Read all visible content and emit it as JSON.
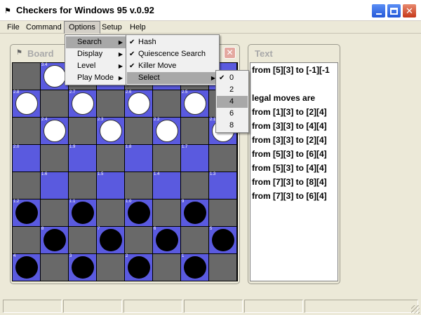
{
  "window": {
    "title": "Checkers for Windows 95 v.0.92",
    "icon": "checkers-app-icon"
  },
  "menubar": [
    "File",
    "Command",
    "Options",
    "Setup",
    "Help"
  ],
  "options_menu": [
    "Search",
    "Display",
    "Level",
    "Play Mode"
  ],
  "search_menu": [
    {
      "label": "Hash",
      "checked": true
    },
    {
      "label": "Quiescence Search",
      "checked": true
    },
    {
      "label": "Killer Move",
      "checked": true
    },
    {
      "label": "Select",
      "checked": false
    }
  ],
  "select_menu": [
    {
      "label": "0",
      "checked": true
    },
    {
      "label": "2",
      "checked": false
    },
    {
      "label": "4",
      "checked": false,
      "highlighted": true
    },
    {
      "label": "6",
      "checked": false
    },
    {
      "label": "8",
      "checked": false
    }
  ],
  "board_panel": {
    "title": "Board"
  },
  "board": {
    "rows": [
      [
        {
          "c": "dark"
        },
        {
          "c": "light",
          "n": "3.4",
          "p": "white"
        },
        {
          "c": "dark"
        },
        {
          "c": "light"
        },
        {
          "c": "dark"
        },
        {
          "c": "light"
        },
        {
          "c": "dark"
        },
        {
          "c": "light"
        }
      ],
      [
        {
          "c": "light",
          "n": "2.8",
          "p": "white"
        },
        {
          "c": "dark"
        },
        {
          "c": "light",
          "n": "2.7",
          "p": "white"
        },
        {
          "c": "dark"
        },
        {
          "c": "light",
          "n": "2.6",
          "p": "white"
        },
        {
          "c": "dark"
        },
        {
          "c": "light",
          "n": "2.5",
          "p": "white"
        },
        {
          "c": "dark"
        }
      ],
      [
        {
          "c": "dark"
        },
        {
          "c": "light",
          "n": "2.4",
          "p": "white"
        },
        {
          "c": "dark"
        },
        {
          "c": "light",
          "n": "2.3",
          "p": "white"
        },
        {
          "c": "dark"
        },
        {
          "c": "light",
          "n": "2.2",
          "p": "white"
        },
        {
          "c": "dark"
        },
        {
          "c": "light",
          "n": "2.1",
          "p": "white"
        }
      ],
      [
        {
          "c": "light",
          "n": "2.0"
        },
        {
          "c": "dark"
        },
        {
          "c": "light",
          "n": "1.9"
        },
        {
          "c": "dark"
        },
        {
          "c": "light",
          "n": "1.8"
        },
        {
          "c": "dark"
        },
        {
          "c": "light",
          "n": "1.7"
        },
        {
          "c": "dark"
        }
      ],
      [
        {
          "c": "dark"
        },
        {
          "c": "light",
          "n": "1.6"
        },
        {
          "c": "dark"
        },
        {
          "c": "light",
          "n": "1.5"
        },
        {
          "c": "dark"
        },
        {
          "c": "light",
          "n": "1.4"
        },
        {
          "c": "dark"
        },
        {
          "c": "light",
          "n": "1.3"
        }
      ],
      [
        {
          "c": "light",
          "n": "1.2",
          "p": "black"
        },
        {
          "c": "dark"
        },
        {
          "c": "light",
          "n": "1.1",
          "p": "black"
        },
        {
          "c": "dark"
        },
        {
          "c": "light",
          "n": "1.0",
          "p": "black"
        },
        {
          "c": "dark"
        },
        {
          "c": "light",
          "n": "9",
          "p": "black"
        },
        {
          "c": "dark"
        }
      ],
      [
        {
          "c": "dark"
        },
        {
          "c": "light",
          "n": "8",
          "p": "black"
        },
        {
          "c": "dark"
        },
        {
          "c": "light",
          "n": "7",
          "p": "black"
        },
        {
          "c": "dark"
        },
        {
          "c": "light",
          "n": "6",
          "p": "black"
        },
        {
          "c": "dark"
        },
        {
          "c": "light",
          "n": "5",
          "p": "black"
        }
      ],
      [
        {
          "c": "light",
          "n": "4",
          "p": "black"
        },
        {
          "c": "dark"
        },
        {
          "c": "light",
          "n": "3",
          "p": "black"
        },
        {
          "c": "dark"
        },
        {
          "c": "light",
          "n": "2",
          "p": "black"
        },
        {
          "c": "dark"
        },
        {
          "c": "light",
          "n": "1",
          "p": "black"
        },
        {
          "c": "dark"
        }
      ]
    ]
  },
  "text_panel": {
    "title": "Text",
    "lines": [
      "from [5][3] to [-1][-1",
      "",
      "legal moves are",
      "from [1][3] to [2][4]",
      "from [3][3] to [4][4]",
      "from [3][3] to [2][4]",
      "from [5][3] to [6][4]",
      "from [5][3] to [4][4]",
      "from [7][3] to [8][4]",
      "from [7][3] to [6][4]"
    ]
  },
  "statusbar": {
    "panes": [
      "",
      "",
      "",
      "",
      "",
      ""
    ]
  },
  "colors": {
    "light_square": "#5a5adf",
    "dark_square": "#696969",
    "menu_highlight": "#a8a8a8"
  }
}
